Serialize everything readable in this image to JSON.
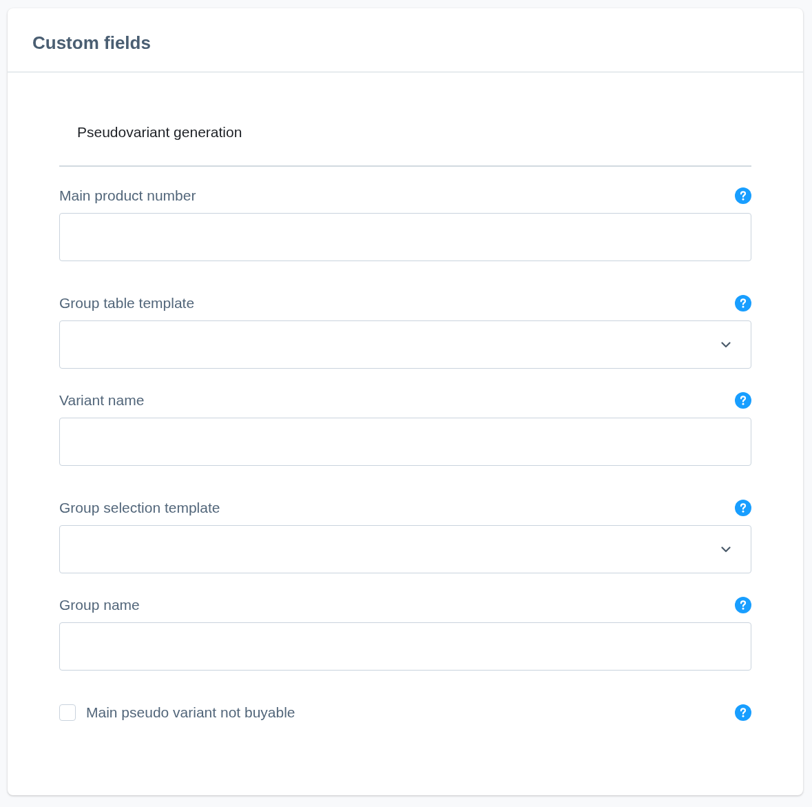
{
  "card": {
    "title": "Custom fields"
  },
  "tabs": [
    {
      "label": "Pseudovariant generation",
      "selected": true
    }
  ],
  "fields": [
    {
      "kind": "text",
      "label": "Main product number"
    },
    {
      "kind": "select",
      "label": "Group table template"
    },
    {
      "kind": "text",
      "label": "Variant name"
    },
    {
      "kind": "select",
      "label": "Group selection template"
    },
    {
      "kind": "text",
      "label": "Group name"
    }
  ],
  "checkbox": {
    "label": "Main pseudo variant not buyable",
    "checked": false
  }
}
